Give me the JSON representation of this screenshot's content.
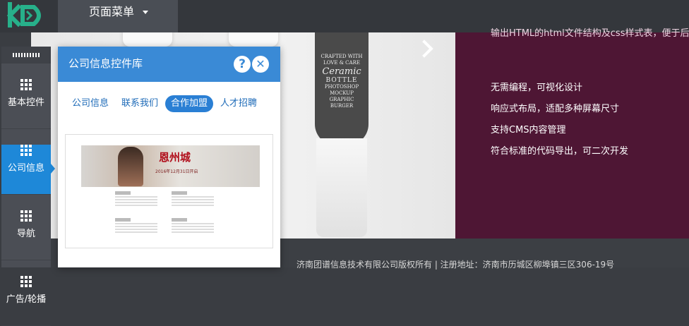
{
  "topbar": {
    "menu_label": "页面菜单"
  },
  "hero": {
    "bottle_text_top": "CRAFTED WITH",
    "bottle_text_mid1": "LOVE & CARE",
    "bottle_brand": "Ceramic",
    "bottle_type": "BOTTLE",
    "bottle_line1": "PHOTOSHOP",
    "bottle_line2": "MOCKUP",
    "bottle_line3": "GRAPHIC BURGER"
  },
  "side_panel": {
    "top_text": "输出HTML的html文件结构及css样式表，便于后",
    "features": [
      "无需编程，可视化设计",
      "响应式布局，适配多种屏幕尺寸",
      "支持CMS内容管理",
      "符合标准的代码导出，可二次开发"
    ]
  },
  "footer": {
    "text": "济南团谱信息技术有限公司版权所有 | 注册地址：济南市历城区柳埠镇三区306-19号"
  },
  "toolbar": {
    "items": [
      {
        "label": "基本控件"
      },
      {
        "label": "公司信息"
      },
      {
        "label": "导航"
      },
      {
        "label": "广告/轮播"
      }
    ]
  },
  "dialog": {
    "title": "公司信息控件库",
    "help_symbol": "?",
    "close_symbol": "✕",
    "tabs": [
      {
        "label": "公司信息"
      },
      {
        "label": "联系我们"
      },
      {
        "label": "合作加盟"
      },
      {
        "label": "人才招聘"
      }
    ],
    "banner_title": "恩州城",
    "banner_sub": "2016年12月31日开启"
  },
  "colors": {
    "accent": "#1e88d8",
    "dialog_header": "#3a8ad6",
    "side_panel": "#4e1634",
    "topbar": "#34373c"
  }
}
